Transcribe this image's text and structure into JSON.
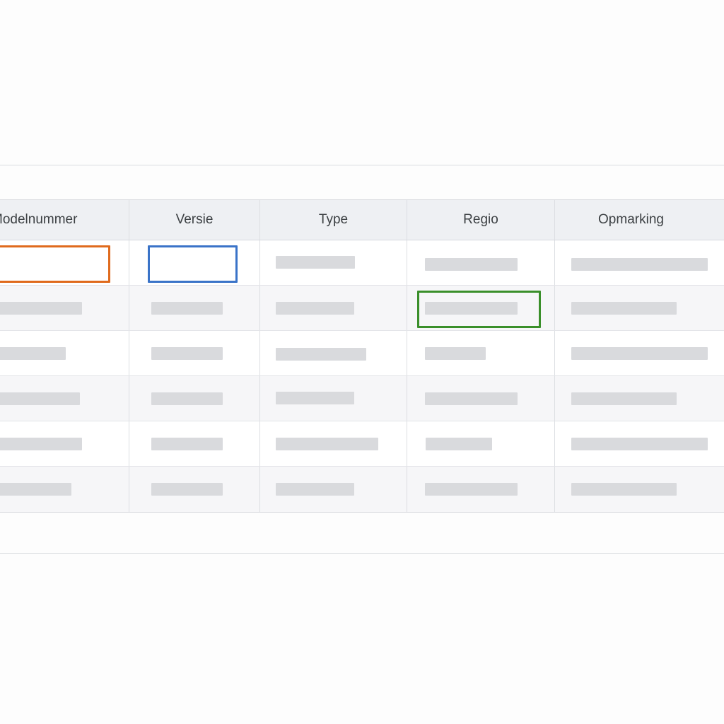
{
  "table": {
    "columns": [
      "Modelnummer",
      "Versie",
      "Type",
      "Regio",
      "Opmarking"
    ]
  },
  "colors": {
    "orange_highlight": "#e06a1d",
    "blue_highlight": "#3a73c8",
    "green_highlight": "#3a8f2a",
    "placeholder_bar": "#d9dadd"
  }
}
